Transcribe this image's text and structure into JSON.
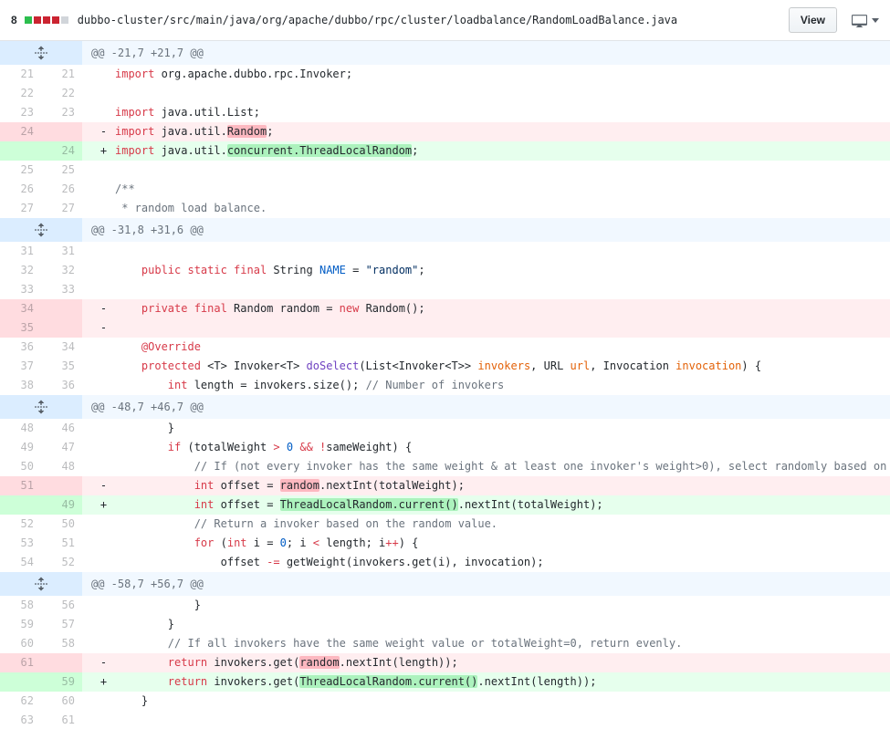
{
  "header": {
    "changes_count": "8",
    "diffstat_colors": [
      "#2cbe4e",
      "#cb2431",
      "#cb2431",
      "#cb2431",
      "#d1d5da"
    ],
    "file_path": "dubbo-cluster/src/main/java/org/apache/dubbo/rpc/cluster/loadbalance/RandomLoadBalance.java",
    "view_button_label": "View"
  },
  "icons": {
    "expand_hunk": "unfold-icon",
    "display_mode": "device-desktop-icon",
    "dropdown": "chevron-down-icon"
  },
  "colors": {
    "addition_bg": "#e6ffed",
    "addition_gutter_bg": "#cdffd8",
    "addition_word_bg": "#acf2bd",
    "deletion_bg": "#ffeef0",
    "deletion_gutter_bg": "#ffdce0",
    "deletion_word_bg": "#fdb8c0",
    "hunk_bg": "#f1f8ff",
    "hunk_gutter_bg": "#dbedff"
  },
  "diff": {
    "markers": {
      "context": " ",
      "del": "-",
      "add": "+"
    },
    "rows": [
      {
        "type": "hunk",
        "text": "@@ -21,7 +21,7 @@"
      },
      {
        "type": "context",
        "old": "21",
        "new": "21",
        "segs": [
          [
            "import ",
            "k"
          ],
          [
            "org.apache.dubbo.rpc.Invoker;",
            "p"
          ]
        ]
      },
      {
        "type": "context",
        "old": "22",
        "new": "22",
        "segs": []
      },
      {
        "type": "context",
        "old": "23",
        "new": "23",
        "segs": [
          [
            "import ",
            "k"
          ],
          [
            "java.util.List;",
            "p"
          ]
        ]
      },
      {
        "type": "del",
        "old": "24",
        "new": "",
        "segs": [
          [
            "import ",
            "k"
          ],
          [
            "java.util.",
            "p"
          ],
          [
            "Random",
            "p",
            "r"
          ],
          [
            ";",
            "p"
          ]
        ]
      },
      {
        "type": "add",
        "old": "",
        "new": "24",
        "segs": [
          [
            "import ",
            "k"
          ],
          [
            "java.util.",
            "p"
          ],
          [
            "concurrent.ThreadLocalRandom",
            "p",
            "g"
          ],
          [
            ";",
            "p"
          ]
        ]
      },
      {
        "type": "context",
        "old": "25",
        "new": "25",
        "segs": []
      },
      {
        "type": "context",
        "old": "26",
        "new": "26",
        "segs": [
          [
            "/**",
            "c"
          ]
        ]
      },
      {
        "type": "context",
        "old": "27",
        "new": "27",
        "segs": [
          [
            " * random load balance.",
            "c"
          ]
        ]
      },
      {
        "type": "hunk",
        "text": "@@ -31,8 +31,6 @@"
      },
      {
        "type": "context",
        "old": "31",
        "new": "31",
        "segs": []
      },
      {
        "type": "context",
        "old": "32",
        "new": "32",
        "segs": [
          [
            "    ",
            "p"
          ],
          [
            "public static final",
            "k"
          ],
          [
            " String ",
            "p"
          ],
          [
            "NAME",
            "b"
          ],
          [
            " = ",
            "p"
          ],
          [
            "\"random\"",
            "s"
          ],
          [
            ";",
            "p"
          ]
        ]
      },
      {
        "type": "context",
        "old": "33",
        "new": "33",
        "segs": []
      },
      {
        "type": "del",
        "old": "34",
        "new": "",
        "segs": [
          [
            "    ",
            "p"
          ],
          [
            "private final",
            "k"
          ],
          [
            " Random random = ",
            "p"
          ],
          [
            "new",
            "k"
          ],
          [
            " Random();",
            "p"
          ]
        ]
      },
      {
        "type": "del",
        "old": "35",
        "new": "",
        "segs": []
      },
      {
        "type": "context",
        "old": "36",
        "new": "34",
        "segs": [
          [
            "    ",
            "p"
          ],
          [
            "@Override",
            "k"
          ]
        ]
      },
      {
        "type": "context",
        "old": "37",
        "new": "35",
        "segs": [
          [
            "    ",
            "p"
          ],
          [
            "protected",
            "k"
          ],
          [
            " <T> Invoker<T> ",
            "p"
          ],
          [
            "doSelect",
            "f"
          ],
          [
            "(List<Invoker<T>> ",
            "p"
          ],
          [
            "invokers",
            "o"
          ],
          [
            ", URL ",
            "p"
          ],
          [
            "url",
            "o"
          ],
          [
            ", Invocation ",
            "p"
          ],
          [
            "invocation",
            "o"
          ],
          [
            ") {",
            "p"
          ]
        ]
      },
      {
        "type": "context",
        "old": "38",
        "new": "36",
        "segs": [
          [
            "        ",
            "p"
          ],
          [
            "int",
            "k"
          ],
          [
            " length = invokers.size(); ",
            "p"
          ],
          [
            "// Number of invokers",
            "c"
          ]
        ]
      },
      {
        "type": "hunk",
        "text": "@@ -48,7 +46,7 @@"
      },
      {
        "type": "context",
        "old": "48",
        "new": "46",
        "segs": [
          [
            "        }",
            "p"
          ]
        ]
      },
      {
        "type": "context",
        "old": "49",
        "new": "47",
        "segs": [
          [
            "        ",
            "p"
          ],
          [
            "if",
            "k"
          ],
          [
            " (totalWeight ",
            "p"
          ],
          [
            ">",
            "k"
          ],
          [
            " ",
            "p"
          ],
          [
            "0",
            "b"
          ],
          [
            " ",
            "p"
          ],
          [
            "&&",
            "k"
          ],
          [
            " ",
            "p"
          ],
          [
            "!",
            "k"
          ],
          [
            "sameWeight) {",
            "p"
          ]
        ]
      },
      {
        "type": "context",
        "old": "50",
        "new": "48",
        "segs": [
          [
            "            ",
            "p"
          ],
          [
            "// If (not every invoker has the same weight & at least one invoker's weight>0), select randomly based on",
            "c"
          ]
        ]
      },
      {
        "type": "del",
        "old": "51",
        "new": "",
        "segs": [
          [
            "            ",
            "p"
          ],
          [
            "int",
            "k"
          ],
          [
            " offset = ",
            "p"
          ],
          [
            "random",
            "p",
            "r"
          ],
          [
            ".nextInt(totalWeight);",
            "p"
          ]
        ]
      },
      {
        "type": "add",
        "old": "",
        "new": "49",
        "segs": [
          [
            "            ",
            "p"
          ],
          [
            "int",
            "k"
          ],
          [
            " offset = ",
            "p"
          ],
          [
            "ThreadLocalRandom.current()",
            "p",
            "g"
          ],
          [
            ".nextInt(totalWeight);",
            "p"
          ]
        ]
      },
      {
        "type": "context",
        "old": "52",
        "new": "50",
        "segs": [
          [
            "            ",
            "p"
          ],
          [
            "// Return a invoker based on the random value.",
            "c"
          ]
        ]
      },
      {
        "type": "context",
        "old": "53",
        "new": "51",
        "segs": [
          [
            "            ",
            "p"
          ],
          [
            "for",
            "k"
          ],
          [
            " (",
            "p"
          ],
          [
            "int",
            "k"
          ],
          [
            " i = ",
            "p"
          ],
          [
            "0",
            "b"
          ],
          [
            "; i ",
            "p"
          ],
          [
            "<",
            "k"
          ],
          [
            " length; i",
            "p"
          ],
          [
            "++",
            "k"
          ],
          [
            ") {",
            "p"
          ]
        ]
      },
      {
        "type": "context",
        "old": "54",
        "new": "52",
        "segs": [
          [
            "                offset ",
            "p"
          ],
          [
            "-=",
            "k"
          ],
          [
            " getWeight(invokers.get(i), invocation);",
            "p"
          ]
        ]
      },
      {
        "type": "hunk",
        "text": "@@ -58,7 +56,7 @@"
      },
      {
        "type": "context",
        "old": "58",
        "new": "56",
        "segs": [
          [
            "            }",
            "p"
          ]
        ]
      },
      {
        "type": "context",
        "old": "59",
        "new": "57",
        "segs": [
          [
            "        }",
            "p"
          ]
        ]
      },
      {
        "type": "context",
        "old": "60",
        "new": "58",
        "segs": [
          [
            "        ",
            "p"
          ],
          [
            "// If all invokers have the same weight value or totalWeight=0, return evenly.",
            "c"
          ]
        ]
      },
      {
        "type": "del",
        "old": "61",
        "new": "",
        "segs": [
          [
            "        ",
            "p"
          ],
          [
            "return",
            "k"
          ],
          [
            " invokers.get(",
            "p"
          ],
          [
            "random",
            "p",
            "r"
          ],
          [
            ".nextInt(length));",
            "p"
          ]
        ]
      },
      {
        "type": "add",
        "old": "",
        "new": "59",
        "segs": [
          [
            "        ",
            "p"
          ],
          [
            "return",
            "k"
          ],
          [
            " invokers.get(",
            "p"
          ],
          [
            "ThreadLocalRandom.current()",
            "p",
            "g"
          ],
          [
            ".nextInt(length));",
            "p"
          ]
        ]
      },
      {
        "type": "context",
        "old": "62",
        "new": "60",
        "segs": [
          [
            "    }",
            "p"
          ]
        ]
      },
      {
        "type": "context",
        "old": "63",
        "new": "61",
        "segs": []
      }
    ]
  }
}
